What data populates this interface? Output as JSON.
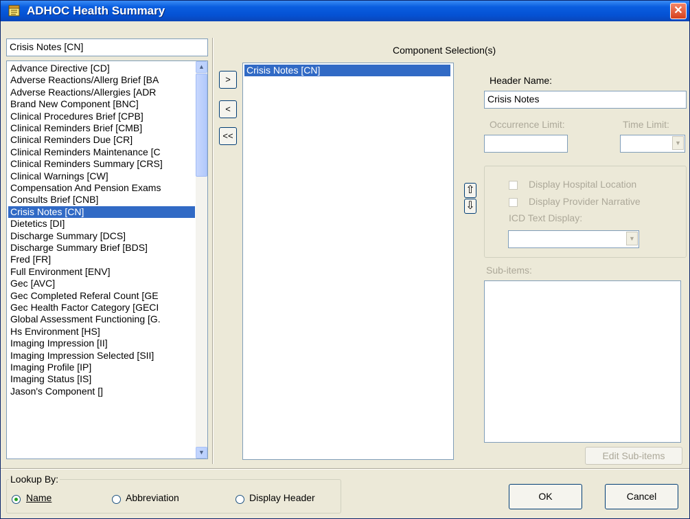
{
  "window": {
    "title": "ADHOC Health Summary",
    "close_glyph": "✕"
  },
  "left": {
    "search_value": "Crisis Notes [CN]",
    "components": [
      "Advance Directive [CD]",
      "Adverse Reactions/Allerg Brief [BA",
      "Adverse Reactions/Allergies [ADR",
      "Brand New Component [BNC]",
      "Clinical Procedures Brief [CPB]",
      "Clinical Reminders Brief [CMB]",
      "Clinical Reminders Due [CR]",
      "Clinical Reminders Maintenance [C",
      "Clinical Reminders Summary [CRS]",
      "Clinical Warnings [CW]",
      "Compensation And Pension Exams",
      "Consults Brief [CNB]",
      "Crisis Notes [CN]",
      "Dietetics [DI]",
      "Discharge Summary [DCS]",
      "Discharge Summary Brief [BDS]",
      "Fred [FR]",
      "Full Environment [ENV]",
      "Gec [AVC]",
      "Gec Completed Referal Count [GE",
      "Gec Health Factor Category [GECI",
      "Global Assessment Functioning [G.",
      "Hs Environment [HS]",
      "Imaging Impression [II]",
      "Imaging Impression Selected [SII]",
      "Imaging Profile [IP]",
      "Imaging Status [IS]",
      "Jason's Component []"
    ],
    "selected_index": 12
  },
  "transfer": {
    "add": ">",
    "remove": "<",
    "remove_all": "<<"
  },
  "middle": {
    "heading": "Component Selection(s)",
    "selected_items": [
      "Crisis Notes [CN]"
    ]
  },
  "reorder": {
    "up_glyph": "⇧",
    "down_glyph": "⇩"
  },
  "right": {
    "header_name_label": "Header Name:",
    "header_name_value": "Crisis Notes",
    "occurrence_label": "Occurrence Limit:",
    "occurrence_value": "",
    "time_label": "Time Limit:",
    "time_value": "",
    "hospital_location_label": "Display Hospital Location",
    "provider_narrative_label": "Display Provider Narrative",
    "icd_label": "ICD Text Display:",
    "icd_value": "",
    "subitems_label": "Sub-items:",
    "edit_subitems": "Edit Sub-items"
  },
  "lookup": {
    "legend": "Lookup By:",
    "options": [
      "Name",
      "Abbreviation",
      "Display Header"
    ],
    "selected": "Name"
  },
  "buttons": {
    "ok": "OK",
    "cancel": "Cancel"
  },
  "colors": {
    "selection": "#316ac5",
    "titlebar": "#0552d4",
    "face": "#ece9d8"
  }
}
